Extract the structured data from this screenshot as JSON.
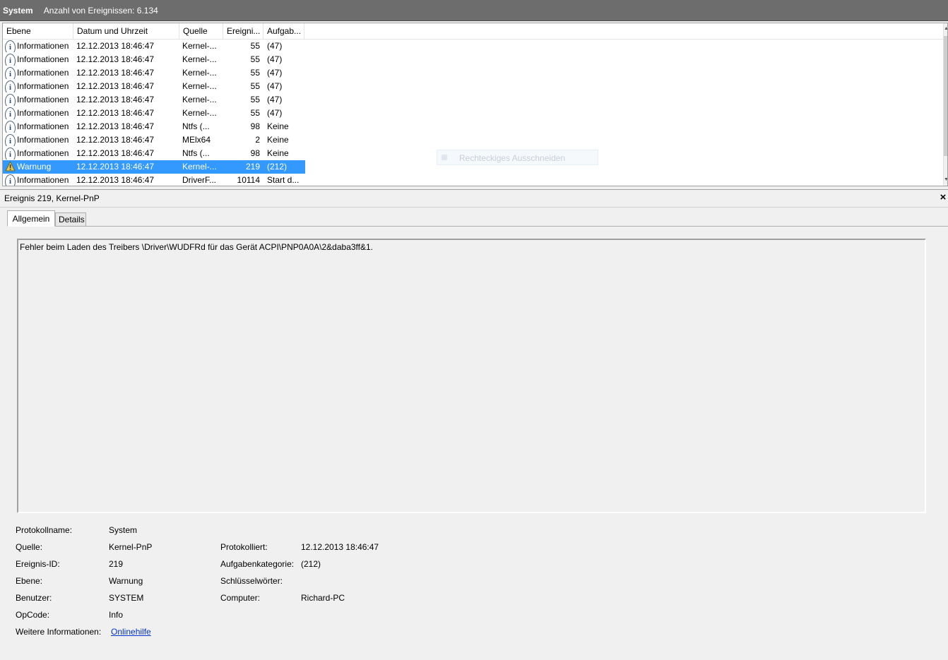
{
  "topbar": {
    "title": "System",
    "count": "Anzahl von Ereignissen: 6.134"
  },
  "columns": [
    "Ebene",
    "Datum und Uhrzeit",
    "Quelle",
    "Ereigni...",
    "Aufgab..."
  ],
  "rows": [
    {
      "icon": "info-icon",
      "level": "Informationen",
      "date": "12.12.2013 18:46:47",
      "source": "Kernel-...",
      "id": "55",
      "task": "(47)"
    },
    {
      "icon": "info-icon",
      "level": "Informationen",
      "date": "12.12.2013 18:46:47",
      "source": "Kernel-...",
      "id": "55",
      "task": "(47)"
    },
    {
      "icon": "info-icon",
      "level": "Informationen",
      "date": "12.12.2013 18:46:47",
      "source": "Kernel-...",
      "id": "55",
      "task": "(47)"
    },
    {
      "icon": "info-icon",
      "level": "Informationen",
      "date": "12.12.2013 18:46:47",
      "source": "Kernel-...",
      "id": "55",
      "task": "(47)"
    },
    {
      "icon": "info-icon",
      "level": "Informationen",
      "date": "12.12.2013 18:46:47",
      "source": "Kernel-...",
      "id": "55",
      "task": "(47)"
    },
    {
      "icon": "info-icon",
      "level": "Informationen",
      "date": "12.12.2013 18:46:47",
      "source": "Kernel-...",
      "id": "55",
      "task": "(47)"
    },
    {
      "icon": "info-icon",
      "level": "Informationen",
      "date": "12.12.2013 18:46:47",
      "source": "Ntfs (...",
      "id": "98",
      "task": "Keine"
    },
    {
      "icon": "info-icon",
      "level": "Informationen",
      "date": "12.12.2013 18:46:47",
      "source": "MElx64",
      "id": "2",
      "task": "Keine"
    },
    {
      "icon": "info-icon",
      "level": "Informationen",
      "date": "12.12.2013 18:46:47",
      "source": "Ntfs (...",
      "id": "98",
      "task": "Keine"
    },
    {
      "icon": "warning-icon",
      "level": "Warnung",
      "date": "12.12.2013 18:46:47",
      "source": "Kernel-...",
      "id": "219",
      "task": "(212)",
      "selected": true
    },
    {
      "icon": "info-icon",
      "level": "Informationen",
      "date": "12.12.2013 18:46:47",
      "source": "DriverF...",
      "id": "10114",
      "task": "Start d..."
    }
  ],
  "ghost_tooltip": "Rechteckiges Ausschneiden",
  "detail": {
    "title": "Ereignis 219, Kernel-PnP",
    "tabs": [
      "Allgemein",
      "Details"
    ],
    "message": "Fehler beim Laden des Treibers \\Driver\\WUDFRd für das Gerät ACPI\\PNP0A0A\\2&daba3ff&1.",
    "left_fields": [
      {
        "label": "Protokollname:",
        "value": "System"
      },
      {
        "label": "Quelle:",
        "value": "Kernel-PnP"
      },
      {
        "label": "Ereignis-ID:",
        "value": "219"
      },
      {
        "label": "Ebene:",
        "value": "Warnung"
      },
      {
        "label": "Benutzer:",
        "value": "SYSTEM"
      },
      {
        "label": "OpCode:",
        "value": "Info"
      }
    ],
    "right_fields": [
      {
        "label": "Protokolliert:",
        "value": "12.12.2013 18:46:47"
      },
      {
        "label": "Aufgabenkategorie:",
        "value": "(212)"
      },
      {
        "label": "Schlüsselwörter:",
        "value": ""
      },
      {
        "label": "Computer:",
        "value": "Richard-PC"
      }
    ],
    "more_info_label": "Weitere Informationen:",
    "more_info_link": "Onlinehilfe"
  },
  "close_glyph": "×"
}
